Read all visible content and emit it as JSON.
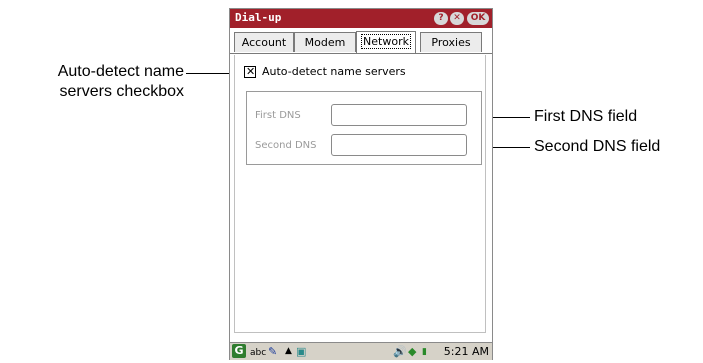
{
  "callouts": {
    "auto_detect": "Auto-detect name servers checkbox",
    "first_dns": "First DNS field",
    "second_dns": "Second DNS field"
  },
  "window": {
    "title": "Dial-up",
    "help_btn": "?",
    "close_btn": "✕",
    "ok_btn": "OK"
  },
  "tabs": [
    {
      "label": "Account",
      "active": false
    },
    {
      "label": "Modem",
      "active": false
    },
    {
      "label": "Network",
      "active": true
    },
    {
      "label": "Proxies",
      "active": false
    }
  ],
  "network": {
    "auto_detect_label": "Auto-detect name servers",
    "auto_detect_checked": true,
    "first_dns_label": "First DNS",
    "first_dns_value": "",
    "second_dns_label": "Second DNS",
    "second_dns_value": ""
  },
  "statusbar": {
    "input_mode": "abc",
    "time": "5:21 AM"
  },
  "colors": {
    "titlebar": "#a1202a",
    "statusbar": "#d6d2c8"
  }
}
